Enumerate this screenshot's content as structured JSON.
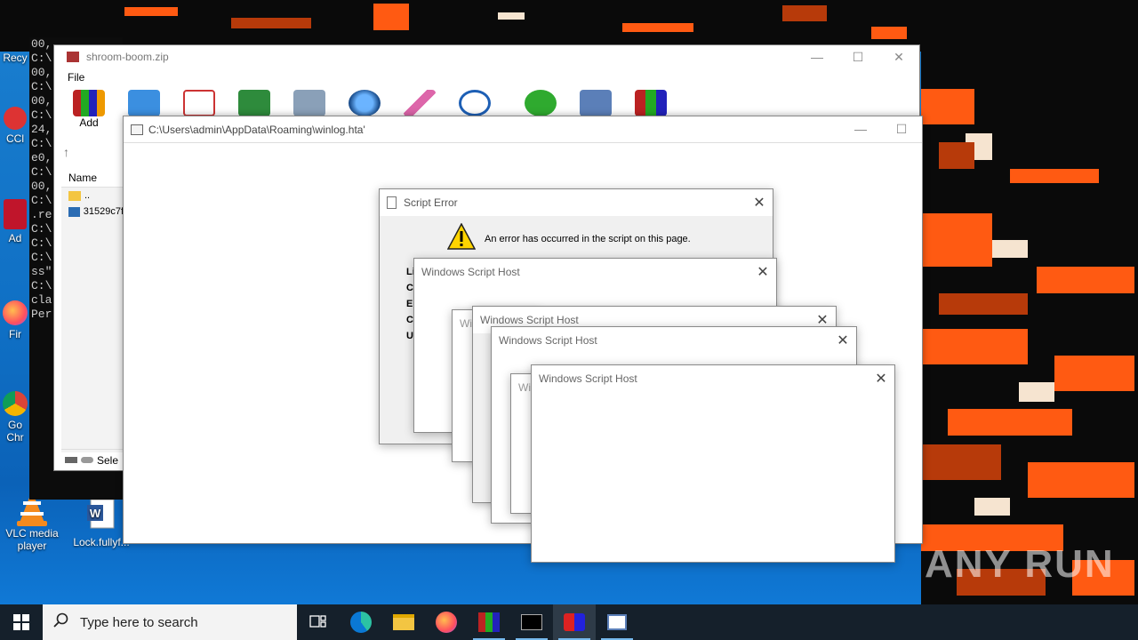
{
  "desktop": {
    "icons": [
      {
        "label": "Recy"
      },
      {
        "label": "CCl"
      },
      {
        "label": "Ad"
      },
      {
        "label": "Fir"
      },
      {
        "label": "Go Chr"
      },
      {
        "label": "VLC media player"
      },
      {
        "label": "Lock.fullyf..."
      }
    ]
  },
  "console": {
    "lines": [
      "00,",
      "C:\\",
      "00,",
      "",
      "C:\\",
      "00,",
      "C:\\",
      "24,",
      "",
      "C:\\",
      "e0,",
      "",
      "C:\\",
      "00,",
      "",
      "C:\\",
      ".re",
      "C:\\",
      "",
      "C:\\",
      "",
      "C:\\",
      "ss\"",
      "C:\\",
      "cla",
      "Perr"
    ]
  },
  "winrar": {
    "title": "shroom-boom.zip",
    "menu_file": "File",
    "toolbar_add": "Add",
    "col_name": "Name",
    "rows": [
      "..",
      "31529c7f"
    ],
    "status": "Sele"
  },
  "hta": {
    "title": "C:\\Users\\admin\\AppData\\Roaming\\winlog.hta'"
  },
  "script_error": {
    "title": "Script Error",
    "message": "An error has occurred in the script on this page.",
    "labels": [
      "Li",
      "Ch",
      "Er",
      "Co",
      "Ul"
    ]
  },
  "wsh": {
    "title": "Windows Script Host",
    "partial": "Wi"
  },
  "taskbar": {
    "search_placeholder": "Type here to search"
  },
  "watermark": "ANY RUN",
  "colors": {
    "accent_orange": "#ff5a12",
    "desktop_blue": "#0f6fc4",
    "taskbar": "#15202b"
  }
}
